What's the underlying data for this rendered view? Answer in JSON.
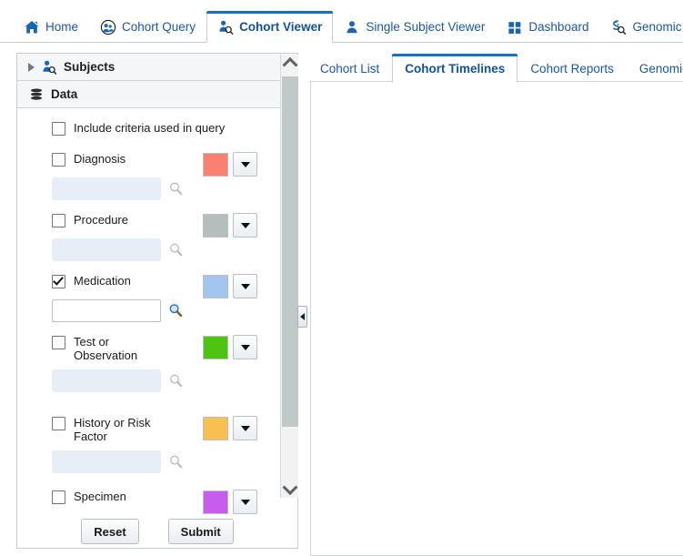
{
  "top_nav": {
    "tabs": [
      {
        "label": "Home",
        "icon": "home-icon",
        "active": false
      },
      {
        "label": "Cohort Query",
        "icon": "cohort-query-icon",
        "active": false
      },
      {
        "label": "Cohort Viewer",
        "icon": "cohort-viewer-icon",
        "active": true
      },
      {
        "label": "Single Subject Viewer",
        "icon": "single-subject-icon",
        "active": false
      },
      {
        "label": "Dashboard",
        "icon": "dashboard-icon",
        "active": false
      },
      {
        "label": "Genomic Query",
        "icon": "genomic-query-icon",
        "active": false
      }
    ]
  },
  "left_panel": {
    "subjects_section": {
      "title": "Subjects",
      "icon": "subjects-icon",
      "expanded": false,
      "toggle_icon": "triangle-right-icon"
    },
    "data_section": {
      "title": "Data",
      "icon": "database-icon",
      "expanded": true
    },
    "include_criteria": {
      "label": "Include criteria used in query",
      "checked": false
    },
    "criteria": [
      {
        "label": "Diagnosis",
        "checked": false,
        "color": "#fa8072",
        "input_value": "",
        "input_enabled": false,
        "dropdown_icon": "caret-down-icon",
        "search_icon": "magnifier-icon"
      },
      {
        "label": "Procedure",
        "checked": false,
        "color": "#b5bdbd",
        "input_value": "",
        "input_enabled": false,
        "dropdown_icon": "caret-down-icon",
        "search_icon": "magnifier-icon"
      },
      {
        "label": "Medication",
        "checked": true,
        "color": "#a3c6ee",
        "input_value": "",
        "input_enabled": true,
        "dropdown_icon": "caret-down-icon",
        "search_icon": "magnifier-icon"
      },
      {
        "label": "Test or Observation",
        "checked": false,
        "color": "#4fc312",
        "input_value": "",
        "input_enabled": false,
        "dropdown_icon": "caret-down-icon",
        "search_icon": "magnifier-icon"
      },
      {
        "label": "History or Risk Factor",
        "checked": false,
        "color": "#f9bf50",
        "input_value": "",
        "input_enabled": false,
        "dropdown_icon": "caret-down-icon",
        "search_icon": "magnifier-icon"
      },
      {
        "label": "Specimen",
        "checked": false,
        "color": "#c65def",
        "input_value": "",
        "input_enabled": false,
        "dropdown_icon": "caret-down-icon",
        "search_icon": "magnifier-icon"
      }
    ],
    "buttons": {
      "reset_label": "Reset",
      "submit_label": "Submit"
    },
    "scrollbar": {
      "up_icon": "chevron-up-icon",
      "down_icon": "chevron-down-icon"
    },
    "collapse_handle": {
      "icon": "caret-left-icon"
    }
  },
  "right_tabs": {
    "tabs": [
      {
        "label": "Cohort List",
        "active": false
      },
      {
        "label": "Cohort Timelines",
        "active": true
      },
      {
        "label": "Cohort Reports",
        "active": false
      },
      {
        "label": "Genomic Data Export",
        "active": false
      }
    ]
  },
  "colors": {
    "accent": "#1173c7",
    "link": "#1a57a8",
    "panel_border": "#c9ced3",
    "disabled_input": "#e7eef5"
  }
}
